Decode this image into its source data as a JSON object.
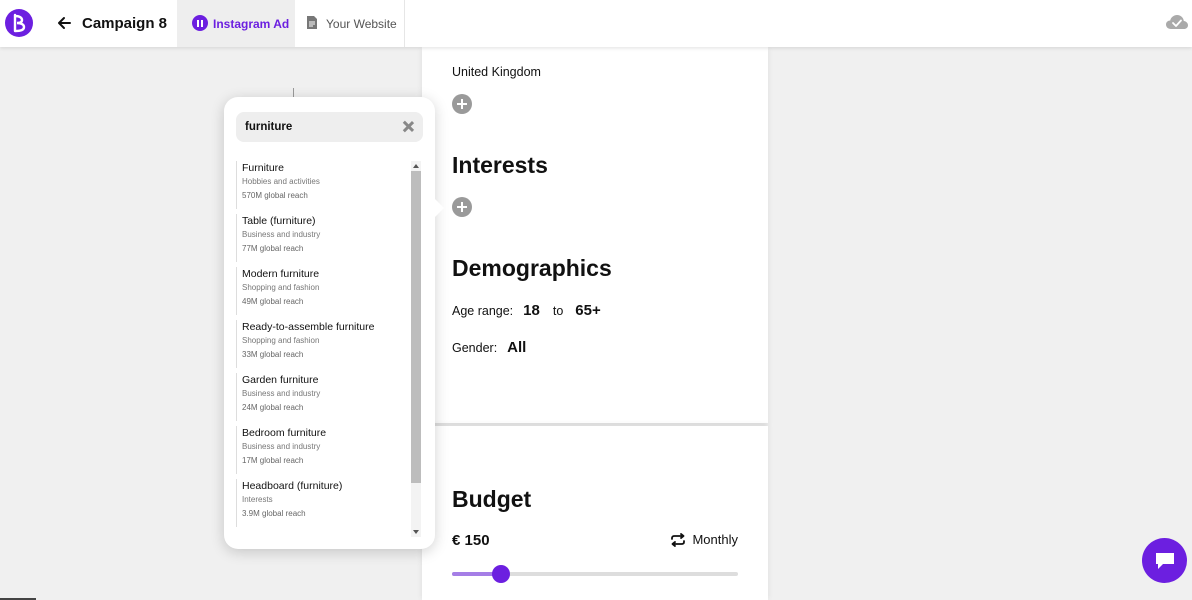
{
  "header": {
    "title": "Campaign 8",
    "tabs": [
      {
        "label": "Instagram Ad",
        "active": true
      },
      {
        "label": "Your Website",
        "active": false
      }
    ]
  },
  "audience": {
    "country": "United Kingdom",
    "interests_heading": "Interests",
    "demographics_heading": "Demographics",
    "age_label": "Age range:",
    "age_from": "18",
    "age_to_word": "to",
    "age_to": "65+",
    "gender_label": "Gender:",
    "gender_value": "All"
  },
  "budget": {
    "heading": "Budget",
    "amount": "€ 150",
    "frequency": "Monthly",
    "slider_fraction": 0.17
  },
  "interest_search": {
    "query": "furniture",
    "results": [
      {
        "name": "Furniture",
        "category": "Hobbies and activities",
        "reach": "570M global reach"
      },
      {
        "name": "Table (furniture)",
        "category": "Business and industry",
        "reach": "77M global reach"
      },
      {
        "name": "Modern furniture",
        "category": "Shopping and fashion",
        "reach": "49M global reach"
      },
      {
        "name": "Ready-to-assemble furniture",
        "category": "Shopping and fashion",
        "reach": "33M global reach"
      },
      {
        "name": "Garden furniture",
        "category": "Business and industry",
        "reach": "24M global reach"
      },
      {
        "name": "Bedroom furniture",
        "category": "Business and industry",
        "reach": "17M global reach"
      },
      {
        "name": "Headboard (furniture)",
        "category": "Interests",
        "reach": "3.9M global reach"
      }
    ]
  },
  "colors": {
    "accent": "#6c1fe0",
    "accent_light": "#a57ee6",
    "background": "#f0f0f0"
  },
  "icons": [
    "logo-icon",
    "back-arrow-icon",
    "pause-icon",
    "document-icon",
    "cloud-check-icon",
    "plus-icon",
    "close-icon",
    "repeat-icon",
    "chat-icon"
  ]
}
